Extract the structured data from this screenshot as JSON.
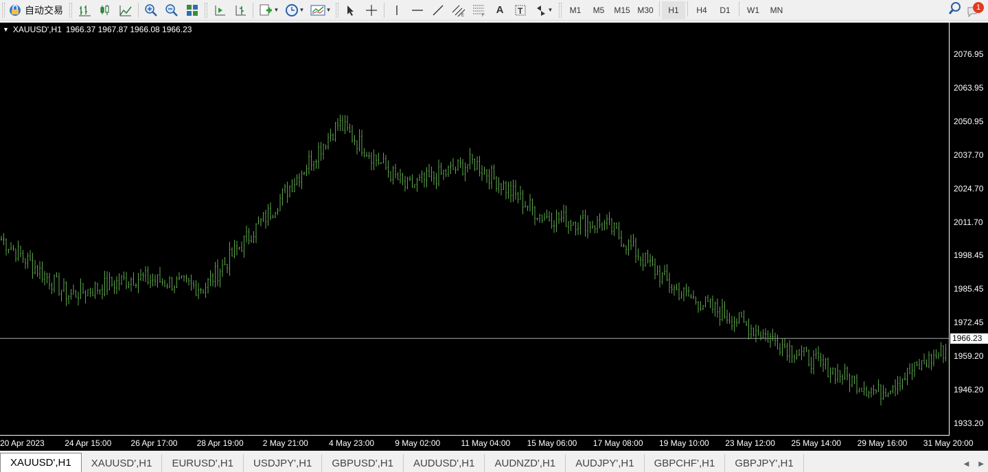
{
  "toolbar": {
    "auto_trade_label": "自动交易",
    "timeframes": [
      "M1",
      "M5",
      "M15",
      "M30",
      "H1",
      "H4",
      "D1",
      "W1",
      "MN"
    ],
    "active_timeframe": "H1",
    "notification_count": "1"
  },
  "chart": {
    "header": {
      "symbol": "XAUUSD',H1",
      "ohlc": "1966.37 1967.87 1966.08 1966.23"
    },
    "current_price": "1966.23",
    "price_labels": [
      "2076.95",
      "2063.95",
      "2050.95",
      "2037.70",
      "2024.70",
      "2011.70",
      "1998.45",
      "1985.45",
      "1972.45",
      "1959.20",
      "1946.20",
      "1933.20"
    ],
    "time_labels": [
      "20 Apr 2023",
      "24 Apr 15:00",
      "26 Apr 17:00",
      "28 Apr 19:00",
      "2 May 21:00",
      "4 May 23:00",
      "9 May 02:00",
      "11 May 04:00",
      "15 May 06:00",
      "17 May 08:00",
      "19 May 10:00",
      "23 May 12:00",
      "25 May 14:00",
      "29 May 16:00",
      "31 May 20:00"
    ],
    "bar_color": "#5ea84b"
  },
  "chart_data": {
    "type": "line",
    "title": "XAUUSD',H1",
    "ylim": [
      1930,
      2083
    ],
    "x": [
      "20 Apr 2023",
      "24 Apr 15:00",
      "26 Apr 17:00",
      "28 Apr 19:00",
      "2 May 21:00",
      "4 May 23:00",
      "9 May 02:00",
      "11 May 04:00",
      "15 May 06:00",
      "17 May 08:00",
      "19 May 10:00",
      "23 May 12:00",
      "25 May 14:00",
      "29 May 16:00",
      "31 May 20:00"
    ],
    "series": [
      {
        "values": [
          2005,
          1983,
          1990,
          1986,
          2016,
          2050,
          2025,
          2035,
          2014,
          2010,
          1985,
          1972,
          1958,
          1945,
          1962
        ]
      }
    ]
  },
  "tabs": [
    "XAUUSD',H1",
    "XAUUSD',H1",
    "EURUSD',H1",
    "USDJPY',H1",
    "GBPUSD',H1",
    "AUDUSD',H1",
    "AUDNZD',H1",
    "AUDJPY',H1",
    "GBPCHF',H1",
    "GBPJPY',H1"
  ]
}
